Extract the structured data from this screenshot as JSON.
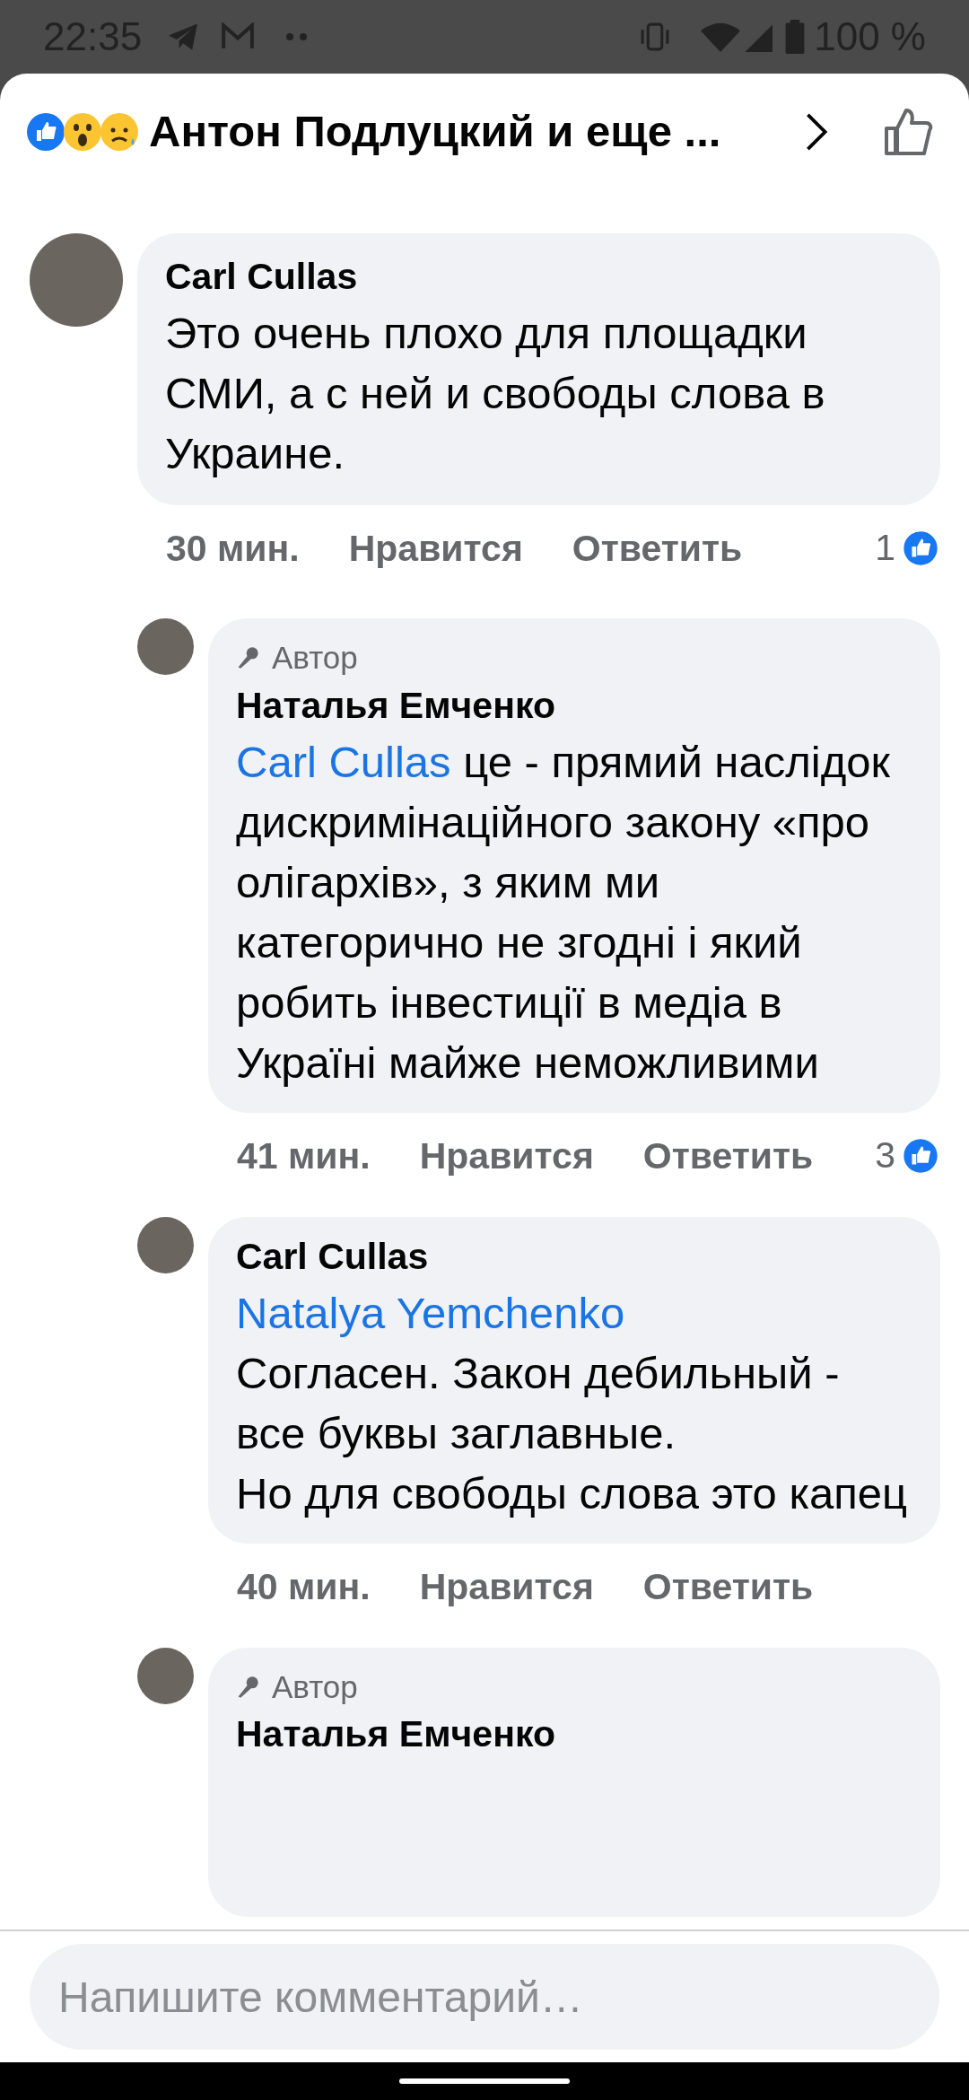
{
  "status_bar": {
    "time": "22:35",
    "battery": "100 %"
  },
  "header": {
    "title": "Антон Подлуцкий и еще ..."
  },
  "comments": [
    {
      "author": "Carl Cullas",
      "body": "Это очень плохо для площадки СМИ, а с ней и свободы слова в Украине.",
      "time": "30 мин.",
      "like": "Нравится",
      "reply": "Ответить",
      "reactions": "1",
      "replies": [
        {
          "author": "Наталья Емченко",
          "author_badge": "Автор",
          "mention": "Carl Cullas",
          "body": " це - прямий наслідок дискримінаційного закону «про олігархів», з яким ми категорично не згодні і який робить інвестиції в медіа в Україні майже неможливими",
          "time": "41 мин.",
          "like": "Нравится",
          "reply": "Ответить",
          "reactions": "3"
        },
        {
          "author": "Carl Cullas",
          "mention": "Natalya Yemchenko",
          "body": "\nСогласен. Закон дебильный - все буквы заглавные.\nНо для свободы слова это капец",
          "time": "40 мин.",
          "like": "Нравится",
          "reply": "Ответить"
        },
        {
          "author": "Наталья Емченко",
          "author_badge": "Автор"
        }
      ]
    }
  ],
  "composer": {
    "placeholder": "Напишите комментарий…"
  }
}
